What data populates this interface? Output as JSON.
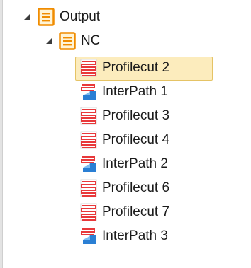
{
  "tree": {
    "root": {
      "label": "Output",
      "icon": "folder-doc-icon",
      "expanded": true,
      "children": [
        {
          "label": "NC",
          "icon": "folder-doc-icon",
          "expanded": true,
          "children": [
            {
              "label": "Profilecut 2",
              "icon": "profilecut-icon",
              "selected": true
            },
            {
              "label": "InterPath 1",
              "icon": "interpath-icon",
              "selected": false
            },
            {
              "label": "Profilecut 3",
              "icon": "profilecut-icon",
              "selected": false
            },
            {
              "label": "Profilecut 4",
              "icon": "profilecut-icon",
              "selected": false
            },
            {
              "label": "InterPath 2",
              "icon": "interpath-icon",
              "selected": false
            },
            {
              "label": "Profilecut 6",
              "icon": "profilecut-icon",
              "selected": false
            },
            {
              "label": "Profilecut 7",
              "icon": "profilecut-icon",
              "selected": false
            },
            {
              "label": "InterPath 3",
              "icon": "interpath-icon",
              "selected": false
            }
          ]
        }
      ]
    }
  },
  "colors": {
    "selection_fill": "#fcecbd",
    "selection_border": "#e5c365",
    "folder_orange": "#f08c00",
    "profile_red": "#e8383a",
    "interpath_blue": "#2a7fd4"
  }
}
